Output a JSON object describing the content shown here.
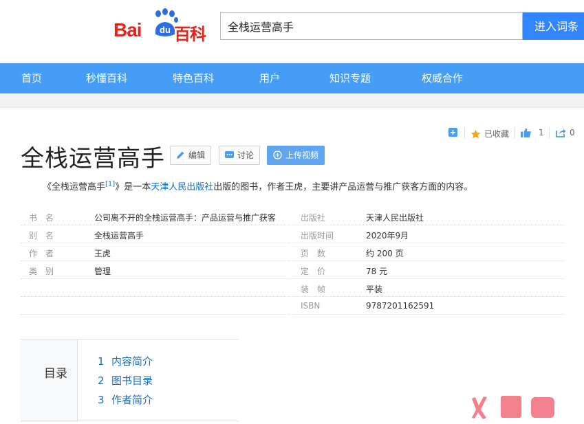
{
  "logo": {
    "bai": "Bai",
    "du": "du",
    "baike": "百科"
  },
  "search": {
    "value": "全栈运营高手",
    "button_label": "进入词条"
  },
  "nav": {
    "items": [
      "首页",
      "秒懂百科",
      "特色百科",
      "用户",
      "知识专题",
      "权威合作"
    ]
  },
  "toolbar": {
    "collected_label": "已收藏",
    "like_count": "1",
    "share_count": "0"
  },
  "entry": {
    "title": "全栈运营高手",
    "buttons": {
      "edit": "编辑",
      "discuss": "讨论",
      "upload_video": "上传视频"
    }
  },
  "summary": {
    "book_title": "《全栈运营高手",
    "ref": "[1]",
    "middle": "》是一本",
    "publisher_link": "天津人民出版社",
    "rest": "出版的图书，作者王虎，主要讲产品运营与推广获客方面的内容。"
  },
  "basic_info": {
    "left": [
      {
        "name": "书　名",
        "value": "公司离不开的全栈运营高手：产品运营与推广获客"
      },
      {
        "name": "别　名",
        "value": "全栈运营高手"
      },
      {
        "name": "作　者",
        "value": "王虎"
      },
      {
        "name": "类　别",
        "value": "管理"
      }
    ],
    "right": [
      {
        "name": "出版社",
        "value": "天津人民出版社"
      },
      {
        "name": "出版时间",
        "value": "2020年9月"
      },
      {
        "name": "页　数",
        "value": "约 200 页"
      },
      {
        "name": "定　价",
        "value": "78 元"
      },
      {
        "name": "装　帧",
        "value": "平装"
      },
      {
        "name": "ISBN",
        "value": "9787201162591"
      }
    ]
  },
  "toc": {
    "title": "目录",
    "items": [
      {
        "num": "1",
        "label": "内容简介"
      },
      {
        "num": "2",
        "label": "图书目录"
      },
      {
        "num": "3",
        "label": "作者简介"
      }
    ]
  },
  "colors": {
    "nav": "#459df5",
    "button": "#3385ff",
    "link": "#136ec2",
    "brand_red": "#e1251b",
    "baike_blue": "#2d6fe0"
  }
}
